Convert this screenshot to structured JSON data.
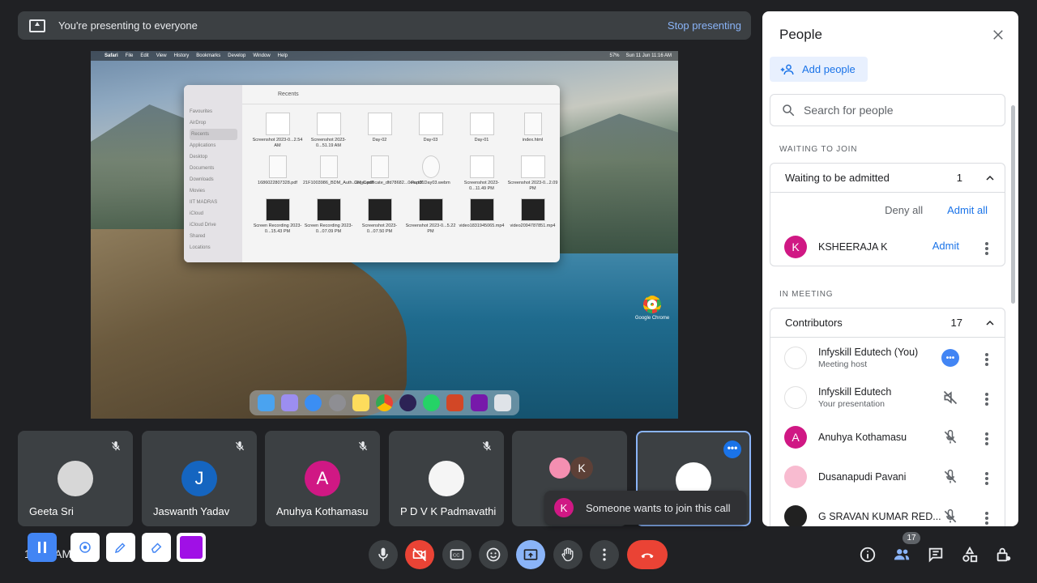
{
  "banner": {
    "text": "You're presenting to everyone",
    "stop": "Stop presenting"
  },
  "shared_screen": {
    "menu": [
      "Safari",
      "File",
      "Edit",
      "View",
      "History",
      "Bookmarks",
      "Develop",
      "Window",
      "Help"
    ],
    "clock": "Sun 11 Jun 11:16 AM",
    "battery": "57%",
    "finder": {
      "title": "Recents",
      "sidebar": [
        "Favourites",
        "AirDrop",
        "Recents",
        "Applications",
        "Desktop",
        "Documents",
        "Downloads",
        "Movies",
        "IIT MADRAS",
        "iCloud",
        "iCloud Drive",
        "Shared",
        "Locations"
      ],
      "files": [
        "Screenshot 2023-0...2.54 AM",
        "Screenshot 2023-0...51.19 AM",
        "Day-02",
        "Day-03",
        "Day-01",
        "index.html",
        "1686022807328.pdf",
        "21F1003986_BDM_Auth...letter.pdf",
        "CN_Certificate_dfd78682...0ee.pdf",
        "Part01Day03.webm",
        "Screenshot 2023-0...11.49 PM",
        "Screenshot 2023-0...2.09 PM",
        "Screen Recording 2023-0...15.43 PM",
        "Screen Recording 2023-0...07.09 PM",
        "Screenshot 2023-0...07.50 PM",
        "Screenshot 2023-0...5.22 PM",
        "video1831945065.mp4",
        "video2094787851.mp4"
      ]
    },
    "desktop_icon": "Google Chrome"
  },
  "tiles": [
    {
      "name": "Geeta Sri",
      "initial": "",
      "color": "#e0e0e0"
    },
    {
      "name": "Jaswanth Yadav",
      "initial": "J",
      "color": "#1565c0"
    },
    {
      "name": "Anuhya Kothamasu",
      "initial": "A",
      "color": "#d01884"
    },
    {
      "name": "P D V K Padmavathi",
      "initial": "",
      "color": "#f5f5f5"
    },
    {
      "name": "",
      "initial": "K",
      "color": "#5d4037"
    },
    {
      "name": "",
      "initial": "",
      "color": "#ffffff"
    }
  ],
  "toast": {
    "initial": "K",
    "text": "Someone wants to join this call"
  },
  "bottom": {
    "clock": "11:16 AM",
    "participants_count": "17"
  },
  "panel": {
    "title": "People",
    "add_people": "Add people",
    "search_placeholder": "Search for people",
    "waiting_label": "WAITING TO JOIN",
    "waiting_box": {
      "title": "Waiting to be admitted",
      "count": "1",
      "deny": "Deny all",
      "admit_all": "Admit all"
    },
    "waiting_person": {
      "initial": "K",
      "name": "KSHEERAJA K",
      "admit": "Admit"
    },
    "meeting_label": "IN MEETING",
    "contributors": {
      "title": "Contributors",
      "count": "17"
    },
    "people": [
      {
        "name": "Infyskill Edutech (You)",
        "sub": "Meeting host",
        "initial": "",
        "color": "#ffffff"
      },
      {
        "name": "Infyskill Edutech",
        "sub": "Your presentation",
        "initial": "",
        "color": "#ffffff"
      },
      {
        "name": "Anuhya Kothamasu",
        "sub": "",
        "initial": "A",
        "color": "#d01884"
      },
      {
        "name": "Dusanapudi Pavani",
        "sub": "",
        "initial": "",
        "color": "#f8bbd0"
      },
      {
        "name": "G SRAVAN KUMAR RED...",
        "sub": "",
        "initial": "",
        "color": "#212121"
      }
    ]
  },
  "colors": {
    "accent": "#1a73e8",
    "end_call": "#ea4335",
    "present": "#8ab4f8"
  }
}
